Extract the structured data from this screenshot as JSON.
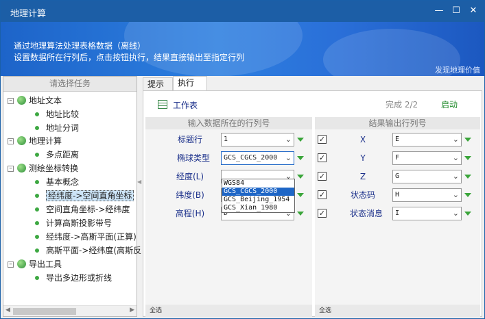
{
  "window": {
    "title": "地理计算"
  },
  "banner": {
    "line1": "通过地理算法处理表格数据（离线）",
    "line2": "设置数据所在行列后，点击按钮执行，结果直接输出至指定行列",
    "brand": "发现地理价值"
  },
  "left_panel": {
    "header": "请选择任务",
    "groups": [
      {
        "label": "地址文本",
        "items": [
          "地址比较",
          "地址分词"
        ]
      },
      {
        "label": "地理计算",
        "items": [
          "多点距离"
        ]
      },
      {
        "label": "测绘坐标转换",
        "items": [
          "基本概念",
          "经纬度->空间直角坐标",
          "空间直角坐标->经纬度",
          "计算高斯投影带号",
          "经纬度->高斯平面(正算)",
          "高斯平面->经纬度(高斯反"
        ]
      },
      {
        "label": "导出工具",
        "items": [
          "导出多边形或折线"
        ]
      }
    ],
    "selected": "经纬度->空间直角坐标"
  },
  "tabs": [
    {
      "label": "提示"
    },
    {
      "label": "执行"
    }
  ],
  "toolbar": {
    "worksheet_label": "工作表",
    "status": "完成 2/2",
    "start_label": "启动"
  },
  "input_section": {
    "header": "输入数据所在的行列号",
    "rows": [
      {
        "label": "标题行",
        "value": "1"
      },
      {
        "label": "椭球类型",
        "value": "GCS_CGCS_2000"
      },
      {
        "label": "经度(L)",
        "value": ""
      },
      {
        "label": "纬度(B)",
        "value": ""
      },
      {
        "label": "高程(H)",
        "value": "D"
      }
    ],
    "footer": "全选"
  },
  "output_section": {
    "header": "结果输出行列号",
    "rows": [
      {
        "label": "X",
        "value": "E",
        "checked": true
      },
      {
        "label": "Y",
        "value": "F",
        "checked": true
      },
      {
        "label": "Z",
        "value": "G",
        "checked": true
      },
      {
        "label": "状态码",
        "value": "H",
        "checked": true
      },
      {
        "label": "状态消息",
        "value": "I",
        "checked": true
      }
    ],
    "footer": "全选"
  },
  "ellipsoid_dropdown": {
    "options": [
      "WGS84",
      "GCS_CGCS_2000",
      "GCS_Beijing_1954",
      "GCS_Xian_1980"
    ],
    "selected": "GCS_CGCS_2000"
  },
  "colors": {
    "titlebar": "#1c5ea6",
    "accent": "#1e66c6",
    "label_text": "#1a2f8a",
    "green": "#3aa53a"
  },
  "icons": {
    "minimize": "minimize-icon",
    "maximize": "maximize-icon",
    "close": "close-icon",
    "globe": "globe-icon",
    "worksheet": "table-icon"
  }
}
